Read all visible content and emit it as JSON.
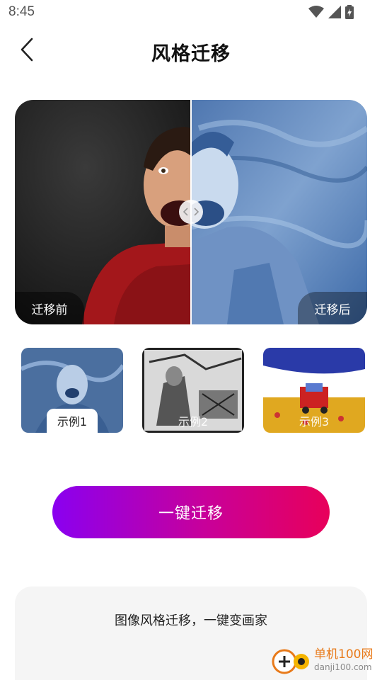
{
  "status_bar": {
    "time": "8:45"
  },
  "header": {
    "title": "风格迁移"
  },
  "compare": {
    "before_label": "迁移前",
    "after_label": "迁移后"
  },
  "examples": [
    {
      "label": "示例1",
      "selected": true
    },
    {
      "label": "示例2",
      "selected": false
    },
    {
      "label": "示例3",
      "selected": false
    }
  ],
  "action": {
    "button_label": "一键迁移"
  },
  "info": {
    "text": "图像风格迁移，一键变画家"
  },
  "watermark": {
    "name": "单机100网",
    "url": "danji100.com"
  },
  "colors": {
    "button_gradient_start": "#8a00f0",
    "button_gradient_end": "#e8005a",
    "card_bg": "#f5f5f5"
  }
}
